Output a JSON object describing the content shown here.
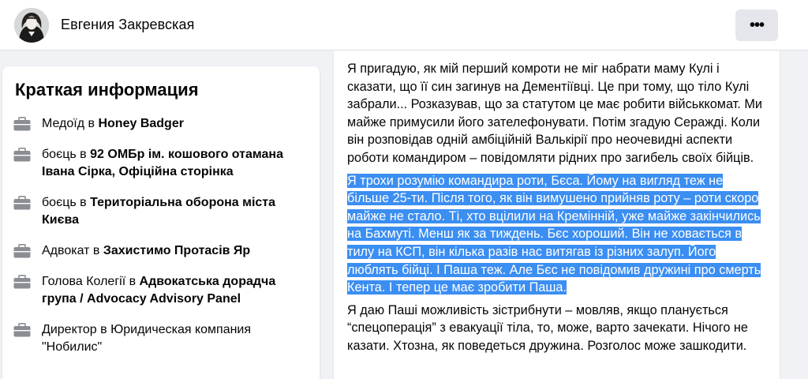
{
  "header": {
    "profile_name": "Евгения Закревская",
    "more_label": "•••"
  },
  "intro": {
    "title": "Краткая информация",
    "items": [
      {
        "prefix": "Медоїд в ",
        "link": "Honey Badger",
        "suffix": ""
      },
      {
        "prefix": "боєць в ",
        "link": "92 ОМБр ім. кошового отамана Івана Сірка, Офіційна сторінка",
        "suffix": ""
      },
      {
        "prefix": "боєць в ",
        "link": "Територіальна оборона міста Києва",
        "suffix": ""
      },
      {
        "prefix": "Адвокат в ",
        "link": "Захистимо Протасів Яр",
        "suffix": ""
      },
      {
        "prefix": "Голова Колегії в ",
        "link": "Адвокатська дорадча група / Advocacy Advisory Panel",
        "suffix": ""
      },
      {
        "prefix": "Директор в Юридическая компания \"Нобилис\"",
        "link": "",
        "suffix": ""
      }
    ]
  },
  "post": {
    "paragraph1": "Я пригадую, як мій перший комроти не міг набрати маму Кулі і сказати, що її син загинув на Дементіївці. Це при тому, що тіло Кулі забрали... Розказував, що за статутом це має робити військкомат. Ми майже примусили його зателефонувати. Потім згадую Сераждi. Коли він розповідав одній амбіційній Валькірії про неочевидні аспекти роботи командиром – повідомляти рідних про загибель своїх бійців.",
    "paragraph2": "Я трохи розумію командира роти, Бєса. Йому на вигляд теж не більше 25-ти. Після того, як він вимушено прийняв роту – роти скоро майже не стало. Ті, хто вцілили на Кремінній, уже майже закінчились на Бахмуті. Менш як за тиждень. Бєс хороший. Він не ховається в тилу на КСП, він кілька разів нас витягав із різних залуп. Його люблять бійці. І Паша теж. Але Бєс не повідомив дружині про смерть Кента. І тепер це має зробити Паша.",
    "paragraph3": "Я даю Паші можливість зістрибнути – мовляв, якщо планується “спецоперація” з евакуації тіла, то, може, варто зачекати. Нічого не казати. Хтозна, як поведеться дружина. Розголос може зашкодити.",
    "highlight_color": "#3b8ef2"
  },
  "colors": {
    "background": "#f0f2f5",
    "card": "#ffffff",
    "button": "#e4e6eb",
    "icon": "#8a8d91"
  }
}
